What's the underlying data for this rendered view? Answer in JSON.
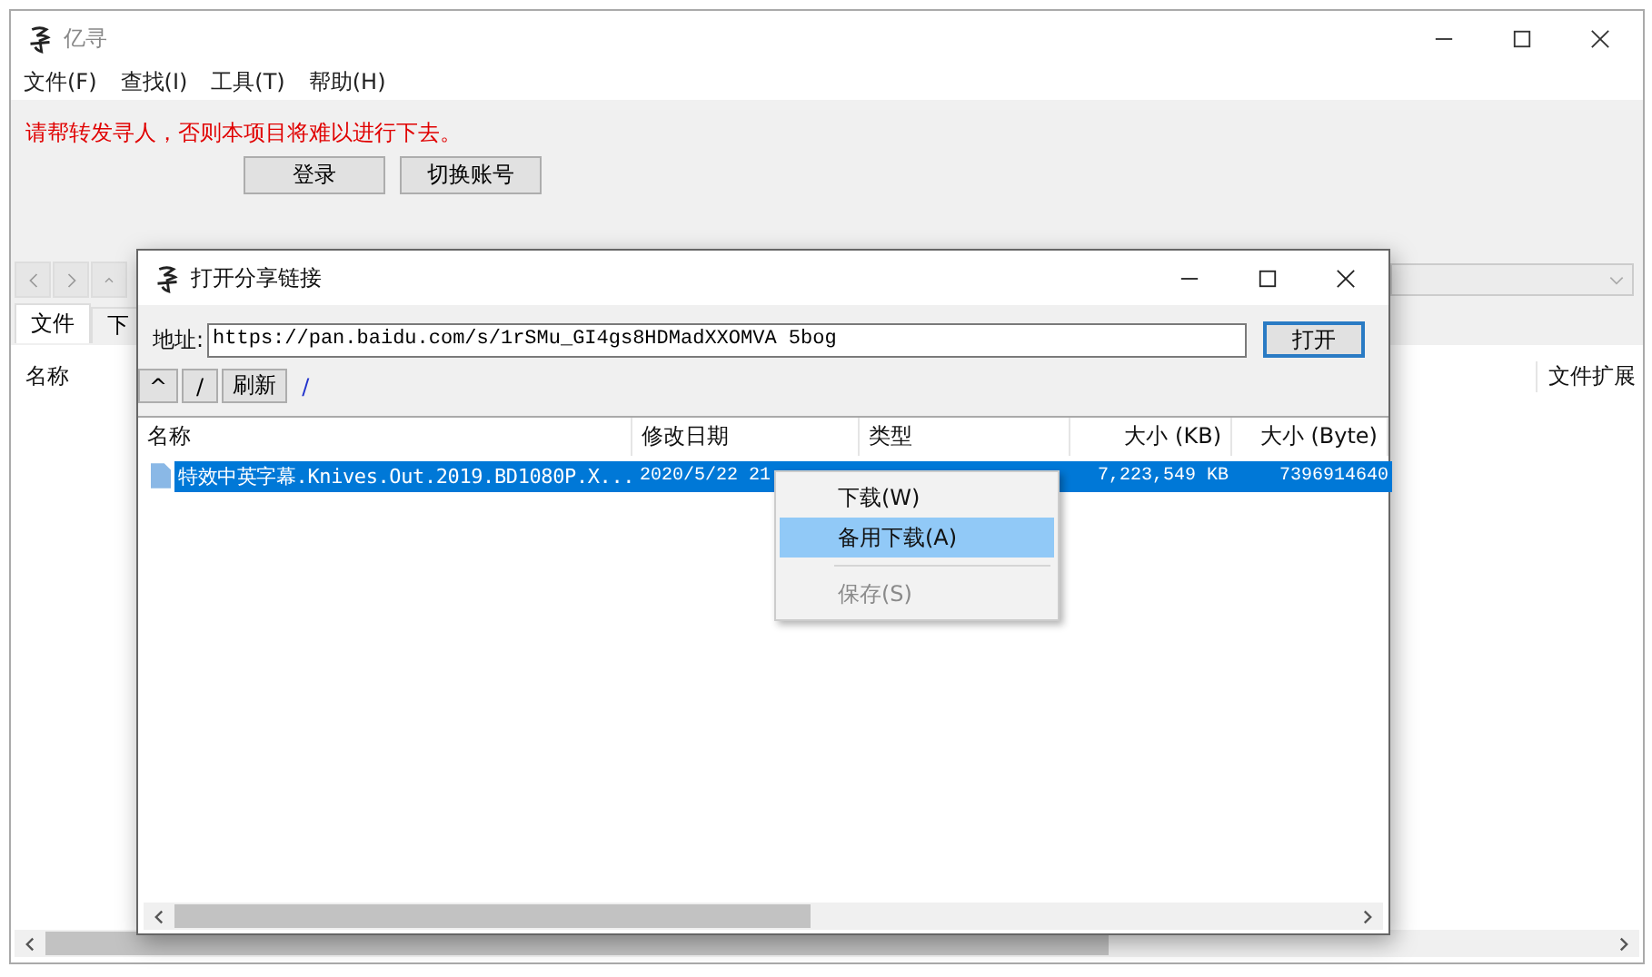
{
  "window": {
    "title": "亿寻"
  },
  "menu": [
    "文件(F)",
    "查找(I)",
    "工具(T)",
    "帮助(H)"
  ],
  "notice": "请帮转发寻人，否则本项目将难以进行下去。",
  "buttons": [
    "登录",
    "切换账号"
  ],
  "tabs": [
    {
      "label": "文件",
      "selected": true
    },
    {
      "label": "下",
      "selected": false
    }
  ],
  "file_list": {
    "columns": [
      "名称",
      "文件扩展"
    ]
  },
  "dialog": {
    "title": "打开分享链接",
    "address_label": "地址:",
    "address": "https://pan.baidu.com/s/1rSMu_GI4gs8HDMadXXOMVA 5bog",
    "open_button": "打开",
    "toolbar": [
      "^",
      "/",
      "刷新"
    ],
    "path": "/",
    "columns": [
      "名称",
      "修改日期",
      "类型",
      "大小 (KB)",
      "大小 (Byte)"
    ],
    "rows": [
      {
        "name": "特效中英字幕.Knives.Out.2019.BD1080P.X...",
        "modified": "2020/5/22 21",
        "size_kb": "7,223,549 KB",
        "size_byte": "7396914640",
        "selected": true
      }
    ]
  },
  "context_menu": [
    {
      "label": "下载(W)",
      "selected": false,
      "disabled": false
    },
    {
      "label": "备用下载(A)",
      "selected": true,
      "disabled": false
    },
    {
      "label": "保存(S)",
      "selected": false,
      "disabled": true
    }
  ]
}
